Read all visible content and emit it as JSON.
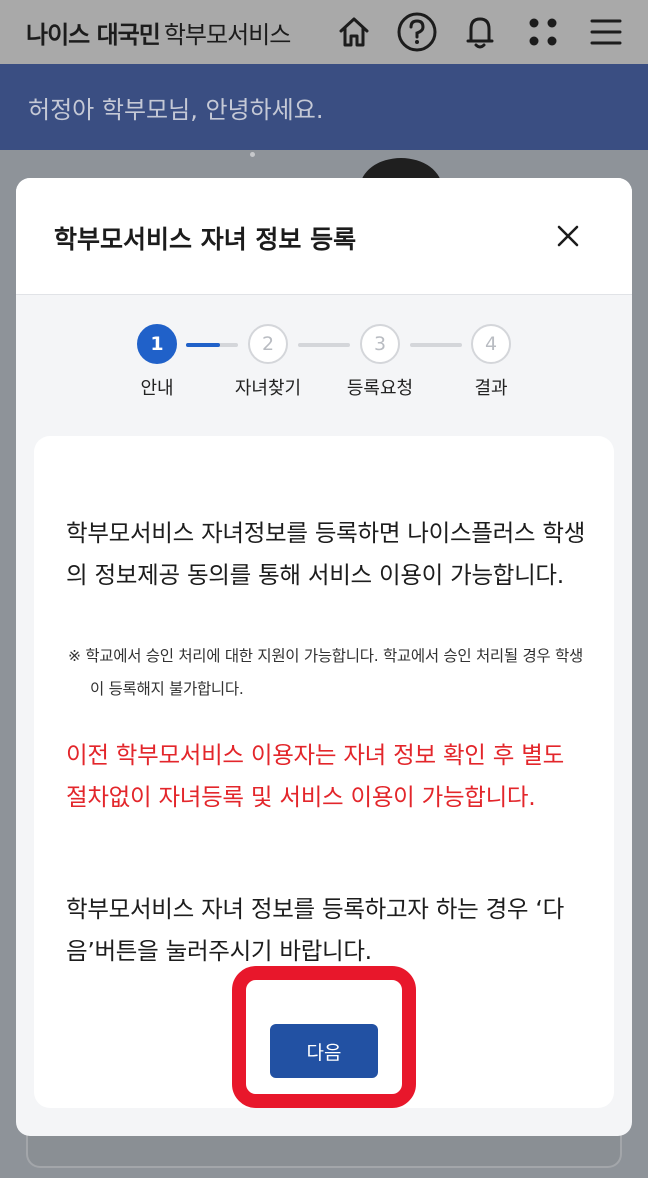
{
  "header": {
    "brand_bold": "나이스 대국민",
    "brand_regular": "학부모서비스",
    "icons": [
      "home-icon",
      "help-icon",
      "bell-icon",
      "apps-icon",
      "menu-icon"
    ]
  },
  "banner": {
    "greeting": "허정아 학부모님, 안녕하세요."
  },
  "modal": {
    "title": "학부모서비스 자녀 정보 등록",
    "steps": [
      {
        "number": "1",
        "label": "안내",
        "active": true
      },
      {
        "number": "2",
        "label": "자녀찾기",
        "active": false
      },
      {
        "number": "3",
        "label": "등록요청",
        "active": false
      },
      {
        "number": "4",
        "label": "결과",
        "active": false
      }
    ],
    "step_progress": 0.65,
    "content": {
      "paragraph1": "학부모서비스 자녀정보를 등록하면 나이스플러스 학생의 정보제공 동의를 통해 서비스 이용이 가능합니다.",
      "note": "※ 학교에서 승인 처리에 대한 지원이 가능합니다. 학교에서 승인 처리될 경우 학생이 등록해지 불가합니다.",
      "paragraph2": "이전 학부모서비스 이용자는 자녀 정보 확인 후 별도 절차없이 자녀등록 및 서비스 이용이 가능합니다.",
      "paragraph3": "학부모서비스 자녀 정보를 등록하고자 하는 경우 ‘다음’버튼을 눌러주시기 바랍니다."
    },
    "next_label": "다음"
  },
  "colors": {
    "primary": "#2061c9",
    "button": "#2251a3",
    "warning_text": "#e3262b",
    "highlight": "#e8172b"
  }
}
